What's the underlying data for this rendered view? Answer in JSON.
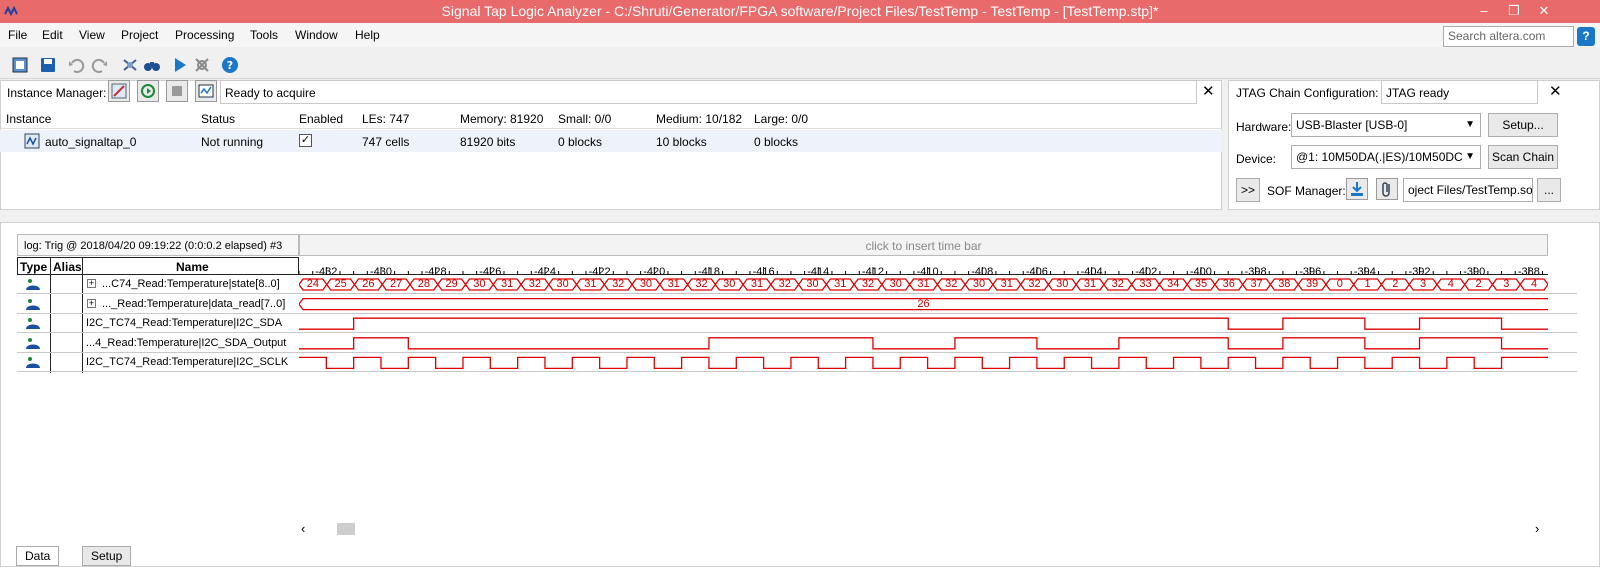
{
  "window": {
    "title": "Signal Tap Logic Analyzer - C:/Shruti/Generator/FPGA software/Project Files/TestTemp - TestTemp - [TestTemp.stp]*",
    "minimize": "–",
    "restore": "❐",
    "close": "✕"
  },
  "menu": [
    "File",
    "Edit",
    "View",
    "Project",
    "Processing",
    "Tools",
    "Window",
    "Help"
  ],
  "search": {
    "placeholder": "Search altera.com",
    "help_label": "?"
  },
  "toolbar_icons": [
    "chip-icon",
    "save-icon",
    "undo-icon",
    "redo-icon",
    "autorun-icon",
    "binoculars-icon",
    "run-icon",
    "stop-analysis-icon",
    "help-icon"
  ],
  "instance_manager": {
    "label": "Instance Manager:",
    "status": "Ready to acquire",
    "columns": [
      "Instance",
      "Status",
      "Enabled",
      "LEs: 747",
      "Memory: 81920",
      "Small: 0/0",
      "Medium: 10/182",
      "Large: 0/0"
    ],
    "rows": [
      {
        "instance": "auto_signaltap_0",
        "status": "Not running",
        "enabled": true,
        "les": "747 cells",
        "memory": "81920 bits",
        "small": "0 blocks",
        "medium": "10 blocks",
        "large": "0 blocks"
      }
    ]
  },
  "jtag": {
    "label": "JTAG Chain Configuration:",
    "status": "JTAG ready",
    "hardware_label": "Hardware:",
    "hardware_value": "USB-Blaster [USB-0]",
    "setup_button": "Setup...",
    "device_label": "Device:",
    "device_value": "@1: 10M50DA(.|ES)/10M50DC",
    "scan_chain_button": "Scan Chain",
    "expand_button": ">>",
    "sof_label": "SOF Manager:",
    "sof_value": "oject Files/TestTemp.sof",
    "browse_button": "..."
  },
  "log": {
    "header": "log: Trig @ 2018/04/20 09:19:22 (0:0:0.2 elapsed) #3",
    "time_bar_hint": "click to insert time bar",
    "columns": {
      "type": "Type",
      "alias": "Alias",
      "name": "Name"
    }
  },
  "timeline": {
    "ticks": [
      "-432",
      "-430",
      "-428",
      "-426",
      "-424",
      "-422",
      "-420",
      "-418",
      "-416",
      "-414",
      "-412",
      "-410",
      "-408",
      "-406",
      "-404",
      "-402",
      "-400",
      "-398",
      "-396",
      "-394",
      "-392",
      "-390",
      "-388"
    ],
    "start": -433.0,
    "end": -387.3
  },
  "signals": [
    {
      "name": "...C74_Read:Temperature|state[8..0]",
      "expandable": true,
      "kind": "bus",
      "values": [
        "24",
        "25",
        "26",
        "27",
        "28",
        "29",
        "30",
        "31",
        "32",
        "30",
        "31",
        "32",
        "30",
        "31",
        "32",
        "30",
        "31",
        "32",
        "30",
        "31",
        "32",
        "30",
        "31",
        "32",
        "30",
        "31",
        "32",
        "30",
        "31",
        "32",
        "33",
        "34",
        "35",
        "36",
        "37",
        "38",
        "39",
        "0",
        "1",
        "2",
        "3",
        "4",
        "2",
        "3",
        "4"
      ]
    },
    {
      "name": "..._Read:Temperature|data_read[7..0]",
      "expandable": true,
      "kind": "bus_const",
      "value": "26"
    },
    {
      "name": "I2C_TC74_Read:Temperature|I2C_SDA",
      "expandable": false,
      "kind": "bit",
      "initial": 0,
      "transitions": [
        -431,
        -399,
        -397,
        -394,
        -392,
        -389
      ]
    },
    {
      "name": "...4_Read:Temperature|I2C_SDA_Output",
      "expandable": false,
      "kind": "bit",
      "initial": 0,
      "transitions": [
        -431,
        -429,
        -418,
        -412,
        -409,
        -406,
        -403,
        -399,
        -397,
        -394,
        -392,
        -389
      ]
    },
    {
      "name": "I2C_TC74_Read:Temperature|I2C_SCLK",
      "expandable": false,
      "kind": "bit",
      "initial": 1,
      "transitions": [
        -432,
        -431,
        -430,
        -429,
        -428,
        -427,
        -426,
        -425,
        -424,
        -423,
        -422,
        -421,
        -420,
        -419,
        -418,
        -417,
        -416,
        -415,
        -414,
        -413,
        -412,
        -411,
        -410,
        -409,
        -408,
        -407,
        -406,
        -405,
        -404,
        -403,
        -402,
        -401,
        -400,
        -399,
        -398,
        -397,
        -396,
        -395,
        -394,
        -393,
        -392,
        -391,
        -390,
        -389
      ]
    }
  ],
  "bottom_tabs": [
    "Data",
    "Setup"
  ],
  "colors": {
    "titlebar": "#e86a6a",
    "wave": "#e00000",
    "accent": "#1b78c8"
  }
}
